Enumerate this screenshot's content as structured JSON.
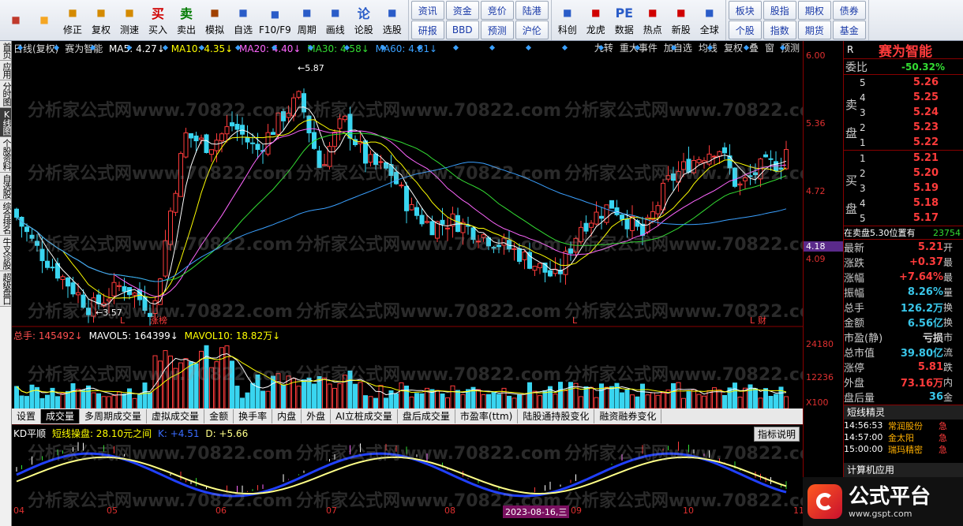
{
  "toolbar": {
    "big_buttons": [
      {
        "label": "",
        "icon": "app-grid-icon",
        "color": "#c0392b"
      },
      {
        "label": "",
        "icon": "back-arrow-icon",
        "color": "#f5a623"
      },
      {
        "label": "修正",
        "icon": "updown-arrow-icon",
        "color": "#d48a00"
      },
      {
        "label": "复权",
        "icon": "restore-icon",
        "color": "#d48a00"
      },
      {
        "label": "测速",
        "icon": "clock-icon",
        "color": "#d48a00"
      },
      {
        "label": "买入",
        "icon": "buy-icon",
        "glyph": "买",
        "color": "#d00000"
      },
      {
        "label": "卖出",
        "icon": "sell-icon",
        "glyph": "卖",
        "color": "#007a00"
      },
      {
        "label": "模拟",
        "icon": "hammer-icon",
        "color": "#a04000"
      },
      {
        "label": "自选",
        "icon": "star-folder-icon",
        "color": "#2a5cc8"
      },
      {
        "label": "F10/F9",
        "icon": "f10-icon",
        "color": "#2a5cc8"
      },
      {
        "label": "周期",
        "icon": "period-icon",
        "color": "#2a5cc8"
      },
      {
        "label": "画线",
        "icon": "pencil-icon",
        "color": "#2a5cc8"
      },
      {
        "label": "论股",
        "icon": "discuss-icon",
        "glyph": "论",
        "color": "#2a5cc8"
      },
      {
        "label": "选股",
        "icon": "select-stock-icon",
        "color": "#2a5cc8"
      }
    ],
    "grid1": [
      "资讯",
      "资金",
      "竞价",
      "陆港",
      "研报",
      "BBD",
      "预测",
      "沪伦"
    ],
    "mid_buttons": [
      {
        "label": "科创",
        "icon": "kechuang-icon",
        "color": "#2a5cc8"
      },
      {
        "label": "龙虎",
        "icon": "dragon-tiger-icon",
        "color": "#d00000"
      },
      {
        "label": "数据",
        "icon": "pe-icon",
        "glyph": "PE",
        "color": "#2a5cc8"
      },
      {
        "label": "热点",
        "icon": "hot-icon",
        "color": "#d00000"
      },
      {
        "label": "新股",
        "icon": "new-stock-icon",
        "color": "#d00000"
      },
      {
        "label": "全球",
        "icon": "globe-icon",
        "color": "#2a5cc8"
      }
    ],
    "grid2": [
      "板块",
      "股指",
      "期权",
      "债券",
      "个股",
      "指数",
      "期货",
      "基金"
    ]
  },
  "left_tabs": [
    "首页",
    "应用",
    "分时图",
    "K线图",
    "个股资料",
    "自选股",
    "综合排名",
    "牛叉诊股",
    "超级盘口"
  ],
  "left_tab_active": "K线图",
  "chart_header": {
    "period": "日线(复权)",
    "stock": "赛为智能",
    "ma5": "MA5: 4.27↓",
    "ma10": "MA10: 4.35↓",
    "ma20": "MA20: 4.40↓",
    "ma30": "MA30: 4.58↓",
    "ma60": "MA60: 4.81↓",
    "buttons": [
      "九转",
      "重大事件",
      "加自选",
      "均线",
      "复权",
      "叠",
      "窗",
      "预测"
    ]
  },
  "price_axis": [
    "6.00",
    "5.36",
    "4.72",
    "4.09"
  ],
  "current_price_tag": "4.18",
  "annotations": {
    "high": "5.87",
    "low": "3.57",
    "marks": [
      "L",
      "涨榜",
      "L",
      "L",
      "财"
    ]
  },
  "volume_header": {
    "total": "总手: 145492↓",
    "mavol5": "MAVOL5: 164399↓",
    "mavol10": "MAVOL10: 18.82万↓"
  },
  "volume_axis": [
    "24180",
    "12236",
    "X100"
  ],
  "indicator_tabs": [
    "设置",
    "成交量",
    "多周期成交量",
    "虚拟成交量",
    "金额",
    "换手率",
    "内盘",
    "外盘",
    "AI立桩成交量",
    "盘后成交量",
    "市盈率(ttm)",
    "陆股通持股变化",
    "融资融券变化"
  ],
  "indicator_active": "成交量",
  "kd_header": {
    "name": "KD平顺",
    "line1": "短线操盘: 28.10元之间",
    "k": "K: +4.51",
    "d": "D: +5.66",
    "help": "指标说明"
  },
  "date_axis": [
    "04",
    "05",
    "06",
    "07",
    "08",
    "2023-08-16,三",
    "09",
    "10",
    "11"
  ],
  "quote": {
    "code_label": "R",
    "name": "赛为智能",
    "weibi_label": "委比",
    "weibi": "-50.32%",
    "sell_label": "卖盘",
    "buy_label": "买盘",
    "asks": [
      {
        "level": "5",
        "price": "5.26"
      },
      {
        "level": "4",
        "price": "5.25"
      },
      {
        "level": "3",
        "price": "5.24"
      },
      {
        "level": "2",
        "price": "5.23"
      },
      {
        "level": "1",
        "price": "5.22"
      }
    ],
    "bids": [
      {
        "level": "1",
        "price": "5.21"
      },
      {
        "level": "2",
        "price": "5.20"
      },
      {
        "level": "3",
        "price": "5.19"
      },
      {
        "level": "4",
        "price": "5.18"
      },
      {
        "level": "5",
        "price": "5.17"
      }
    ],
    "sell_note": "在卖盘5.30位置有",
    "sell_note_val": "23754",
    "stats": [
      {
        "name": "最新",
        "value": "5.21",
        "tail": "开",
        "color": "#ff3b3b"
      },
      {
        "name": "涨跌",
        "value": "+0.37",
        "tail": "最",
        "color": "#ff3b3b"
      },
      {
        "name": "涨幅",
        "value": "+7.64%",
        "tail": "最",
        "color": "#ff3b3b"
      },
      {
        "name": "振幅",
        "value": "8.26%",
        "tail": "量",
        "color": "#39c5e8"
      },
      {
        "name": "总手",
        "value": "126.2万",
        "tail": "换",
        "color": "#39c5e8"
      },
      {
        "name": "金额",
        "value": "6.56亿",
        "tail": "换",
        "color": "#39c5e8"
      },
      {
        "name": "市盈(静)",
        "value": "亏损",
        "tail": "市",
        "color": "#dddddd"
      },
      {
        "name": "总市值",
        "value": "39.80亿",
        "tail": "流",
        "color": "#39c5e8"
      },
      {
        "name": "涨停",
        "value": "5.81",
        "tail": "跌",
        "color": "#ff3b3b"
      },
      {
        "name": "外盘",
        "value": "73.16万",
        "tail": "内",
        "color": "#ff3b3b"
      },
      {
        "name": "盘后量",
        "value": "36",
        "tail": "金",
        "color": "#39c5e8"
      }
    ],
    "elves_title": "短线精灵",
    "elves": [
      {
        "time": "14:56:53",
        "name": "常润股份",
        "event": "急"
      },
      {
        "time": "14:57:00",
        "name": "金太阳",
        "event": "急"
      },
      {
        "time": "15:00:00",
        "name": "瑞玛精密",
        "event": "急"
      }
    ],
    "app_label": "计算机应用"
  },
  "logo": {
    "name": "公式平台",
    "url": "www.gspt.com"
  },
  "watermark": "分析家公式网www.70822.com",
  "colors": {
    "up": "#ff3b3b",
    "down": "#39d5f0",
    "ma5": "#ffffff",
    "ma10": "#ffff00",
    "ma20": "#ff66ff",
    "ma30": "#33dd33",
    "ma60": "#3aa0ff"
  }
}
